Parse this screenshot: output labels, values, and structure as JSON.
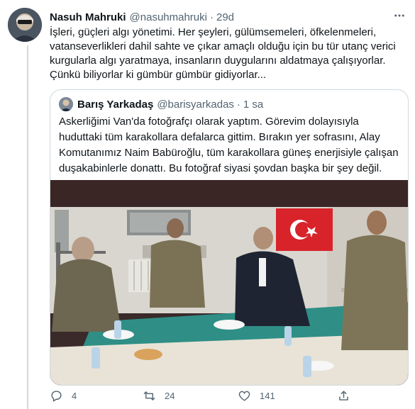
{
  "tweet": {
    "display_name": "Nasuh Mahruki",
    "handle": "@nasuhmahruki",
    "separator": "·",
    "time": "29d",
    "text": "İşleri, güçleri algı yönetimi. Her şeyleri, gülümsemeleri, öfkelenmeleri, vatanseverlikleri dahil sahte ve çıkar amaçlı olduğu için bu tür utanç verici kurgularla algı yaratmaya, insanların duygularını aldatmaya çalışıyorlar. Çünkü biliyorlar ki gümbür gümbür gidiyorlar..."
  },
  "quoted": {
    "display_name": "Barış Yarkadaş",
    "handle": "@barisyarkadas",
    "separator": "·",
    "time": "1 sa",
    "text": "Askerliğimi Van'da fotoğrafçı olarak yaptım. Görevim dolayısıyla huduttaki tüm karakollara defalarca gittim. Bırakın yer sofrasını, Alay Komutanımız Naim Babüroğlu, tüm karakollara güneş enerjisiyle çalışan duşakabinlerle donattı. Bu fotoğraf siyasi şovdan başka bir şey değil."
  },
  "actions": {
    "reply_count": "4",
    "retweet_count": "24",
    "like_count": "141"
  },
  "icons": [
    "more-icon",
    "reply-icon",
    "retweet-icon",
    "like-icon",
    "share-icon"
  ],
  "colors": {
    "text": "#0f1419",
    "secondary": "#536471",
    "border": "#cfd9de",
    "flag_red": "#d8232a"
  }
}
